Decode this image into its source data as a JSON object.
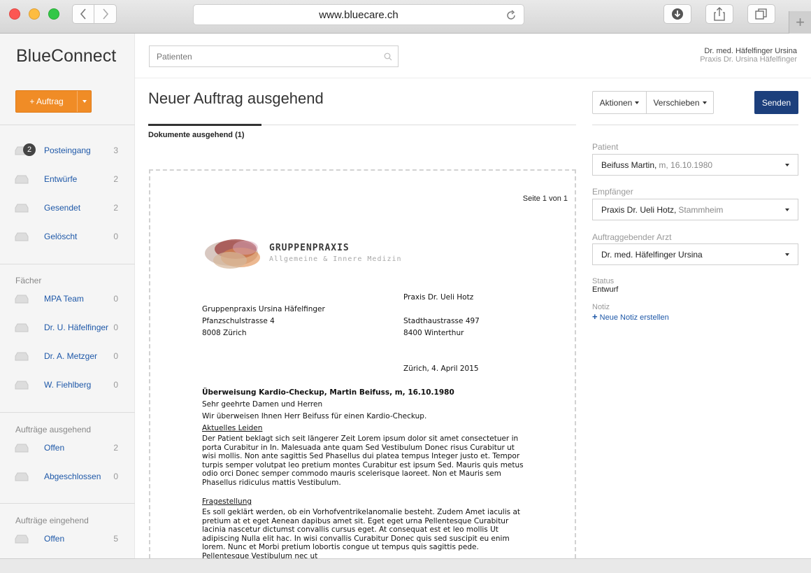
{
  "browser": {
    "url": "www.bluecare.ch"
  },
  "app": {
    "brand": "BlueConnect",
    "search_placeholder": "Patienten",
    "user": {
      "name": "Dr. med. Häfelfinger Ursina",
      "practice": "Praxis Dr. Ursina Häfelfinger"
    }
  },
  "sidebar": {
    "new_order_label": "+ Auftrag",
    "mailbox": [
      {
        "label": "Posteingang",
        "count": "3",
        "badge": "2"
      },
      {
        "label": "Entwürfe",
        "count": "2"
      },
      {
        "label": "Gesendet",
        "count": "2"
      },
      {
        "label": "Gelöscht",
        "count": "0"
      }
    ],
    "faecher_heading": "Fächer",
    "faecher": [
      {
        "label": "MPA Team",
        "count": "0"
      },
      {
        "label": "Dr. U. Häfelfinger",
        "count": "0"
      },
      {
        "label": "Dr. A. Metzger",
        "count": "0"
      },
      {
        "label": "W. Fiehlberg",
        "count": "0"
      }
    ],
    "ausgehend_heading": "Aufträge ausgehend",
    "ausgehend": [
      {
        "label": "Offen",
        "count": "2"
      },
      {
        "label": "Abgeschlossen",
        "count": "0"
      }
    ],
    "eingehend_heading": "Aufträge eingehend",
    "eingehend": [
      {
        "label": "Offen",
        "count": "5"
      }
    ]
  },
  "main": {
    "title": "Neuer Auftrag ausgehend",
    "tab_label": "Dokumente ausgehend (1)"
  },
  "panel": {
    "actions_label": "Aktionen",
    "move_label": "Verschieben",
    "send_label": "Senden",
    "patient_label": "Patient",
    "patient_name": "Beifuss Martin,",
    "patient_detail": "m, 16.10.1980",
    "recipient_label": "Empfänger",
    "recipient_name": "Praxis Dr. Ueli Hotz,",
    "recipient_detail": "Stammheim",
    "doctor_label": "Auftraggebender Arzt",
    "doctor_name": "Dr. med. Häfelfinger Ursina",
    "status_label": "Status",
    "status_value": "Entwurf",
    "note_label": "Notiz",
    "note_link": "Neue Notiz erstellen"
  },
  "document": {
    "page": "Seite 1 von 1",
    "logo_title": "GRUPPENPRAXIS",
    "logo_subtitle": "Allgemeine & Innere Medizin",
    "recipient_name": "Praxis Dr. Ueli Hotz",
    "recipient_street": "Stadthaustrasse 497",
    "recipient_city": "8400 Winterthur",
    "sender_name": "Gruppenpraxis Ursina Häfelfinger",
    "sender_street": "Pfanzschulstrasse 4",
    "sender_city": "8008 Zürich",
    "date": "Zürich, 4. April 2015",
    "subject": "Überweisung Kardio-Checkup, Martin Beifuss, m, 16.10.1980",
    "greeting": "Sehr geehrte Damen und Herren",
    "intro": "Wir überweisen Ihnen Herr Beifuss für einen Kardio-Checkup.",
    "section1_heading": "Aktuelles Leiden",
    "section1_body": "Der Patient beklagt sich seit längerer Zeit Lorem ipsum dolor sit amet consectetuer in porta Curabitur in In. Malesuada ante quam Sed Vestibulum Donec risus Curabitur ut wisi mollis. Non ante sagittis Sed Phasellus dui platea tempus Integer justo et. Tempor turpis semper volutpat leo pretium montes Curabitur est ipsum Sed. Mauris quis metus odio orci Donec semper commodo mauris scelerisque laoreet. Non et Mauris sem Phasellus ridiculus mattis Vestibulum.",
    "section2_heading": "Fragestellung",
    "section2_body": "Es soll geklärt werden, ob ein Vorhofventrikelanomalie besteht. Zudem Amet iaculis at pretium at et eget Aenean dapibus amet sit. Eget eget urna Pellentesque Curabitur lacinia nascetur dictumst convallis cursus eget. At consequat est et leo mollis Ut adipiscing Nulla elit hac. In wisi convallis Curabitur Donec quis sed suscipit eu enim lorem. Nunc et Morbi pretium lobortis congue ut tempus quis sagittis pede. Pellentesque Vestibulum nec ut"
  },
  "colors": {
    "accent_orange": "#f08c26",
    "primary_blue": "#1c3f7c",
    "link_blue": "#1e58a8"
  }
}
